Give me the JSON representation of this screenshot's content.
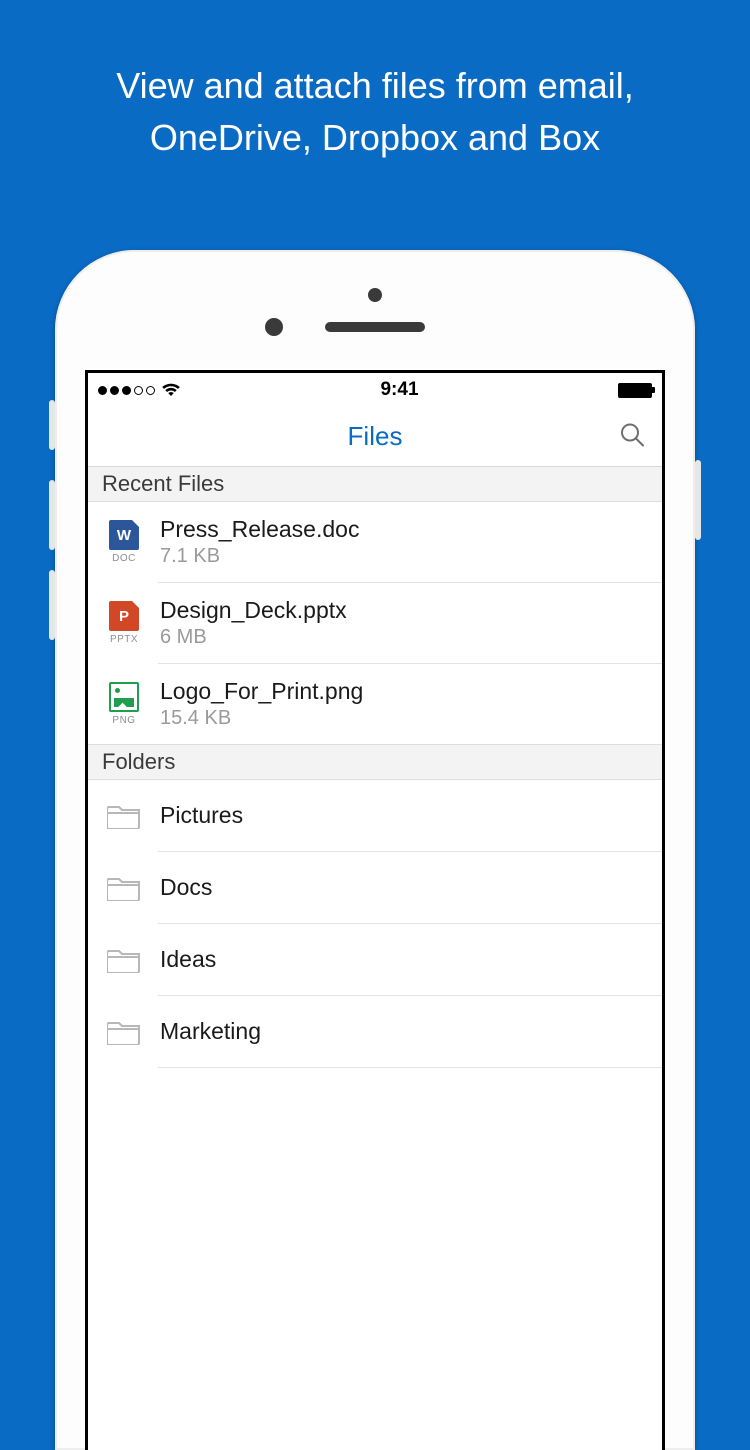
{
  "promo": {
    "line1": "View and attach files from email,",
    "line2": "OneDrive, Dropbox and Box"
  },
  "status": {
    "time": "9:41"
  },
  "nav": {
    "title": "Files"
  },
  "sections": {
    "recent_header": "Recent Files",
    "folders_header": "Folders"
  },
  "files": [
    {
      "name": "Press_Release.doc",
      "size": "7.1 KB",
      "ext": "DOC",
      "icon_letter": "W",
      "icon_type": "word"
    },
    {
      "name": "Design_Deck.pptx",
      "size": "6 MB",
      "ext": "PPTX",
      "icon_letter": "P",
      "icon_type": "ppt"
    },
    {
      "name": "Logo_For_Print.png",
      "size": "15.4 KB",
      "ext": "PNG",
      "icon_letter": "",
      "icon_type": "img"
    }
  ],
  "folders": [
    {
      "name": "Pictures"
    },
    {
      "name": "Docs"
    },
    {
      "name": "Ideas"
    },
    {
      "name": "Marketing"
    }
  ],
  "colors": {
    "accent": "#0a6bc5"
  }
}
